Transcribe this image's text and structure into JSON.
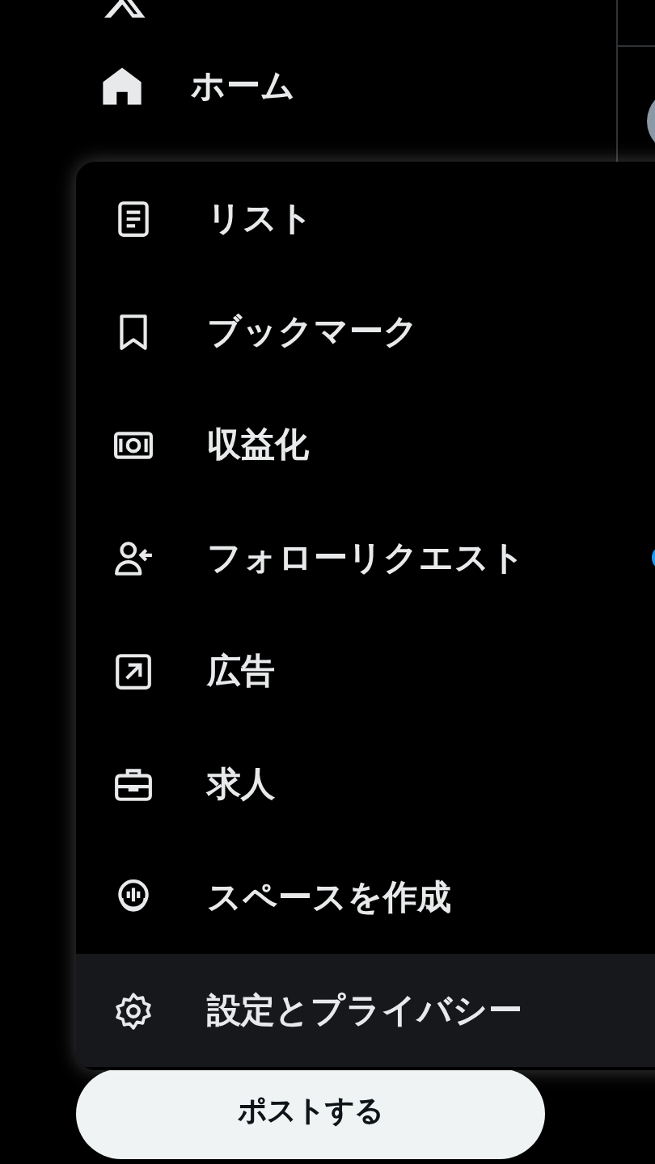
{
  "sidebar": {
    "home": {
      "label": "ホーム"
    }
  },
  "menu": {
    "items": [
      {
        "kind": "list",
        "label": "リスト",
        "selected": false,
        "has_dot": false
      },
      {
        "kind": "bookmark",
        "label": "ブックマーク",
        "selected": false,
        "has_dot": false
      },
      {
        "kind": "money",
        "label": "収益化",
        "selected": false,
        "has_dot": false
      },
      {
        "kind": "follow",
        "label": "フォローリクエスト",
        "selected": false,
        "has_dot": true
      },
      {
        "kind": "ads",
        "label": "広告",
        "selected": false,
        "has_dot": false
      },
      {
        "kind": "jobs",
        "label": "求人",
        "selected": false,
        "has_dot": false
      },
      {
        "kind": "spaces",
        "label": "スペースを作成",
        "selected": false,
        "has_dot": false
      },
      {
        "kind": "settings",
        "label": "設定とプライバシー",
        "selected": true,
        "has_dot": false
      }
    ]
  },
  "post_button": {
    "label": "ポストする"
  }
}
